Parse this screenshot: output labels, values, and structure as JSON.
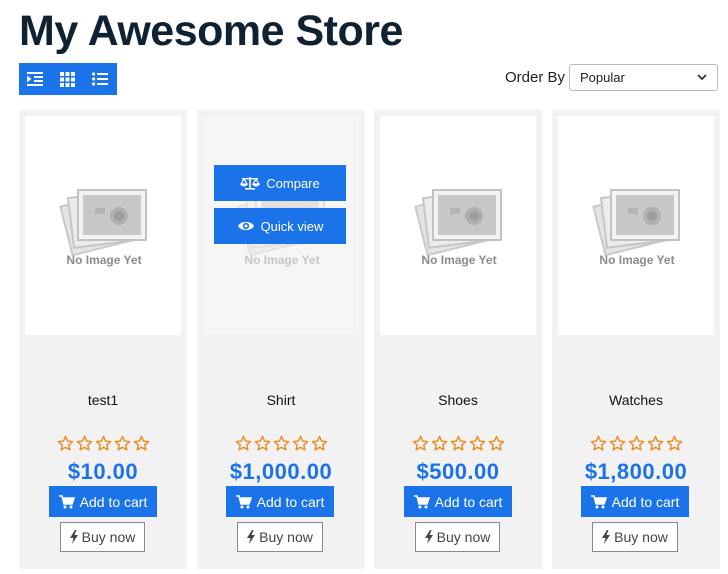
{
  "store": {
    "title": "My Awesome Store"
  },
  "toolbar": {
    "view_buttons": [
      {
        "icon": "indent-icon"
      },
      {
        "icon": "grid-icon"
      },
      {
        "icon": "list-icon"
      }
    ],
    "order_label": "Order By",
    "order_selected": "Popular"
  },
  "colors": {
    "accent": "#1a73e8",
    "star": "#f08a1c",
    "card_bg": "#f2f2f2"
  },
  "placeholder_text": "No Image Yet",
  "hover_actions": {
    "compare": "Compare",
    "quick_view": "Quick view"
  },
  "products": [
    {
      "name": "test1",
      "price": "$10.00",
      "rating": 0,
      "add_to_cart": "Add to cart",
      "buy_now": "Buy now"
    },
    {
      "name": "Shirt",
      "price": "$1,000.00",
      "rating": 0,
      "add_to_cart": "Add to cart",
      "buy_now": "Buy now"
    },
    {
      "name": "Shoes",
      "price": "$500.00",
      "rating": 0,
      "add_to_cart": "Add to cart",
      "buy_now": "Buy now"
    },
    {
      "name": "Watches",
      "price": "$1,800.00",
      "rating": 0,
      "add_to_cart": "Add to cart",
      "buy_now": "Buy now"
    }
  ]
}
